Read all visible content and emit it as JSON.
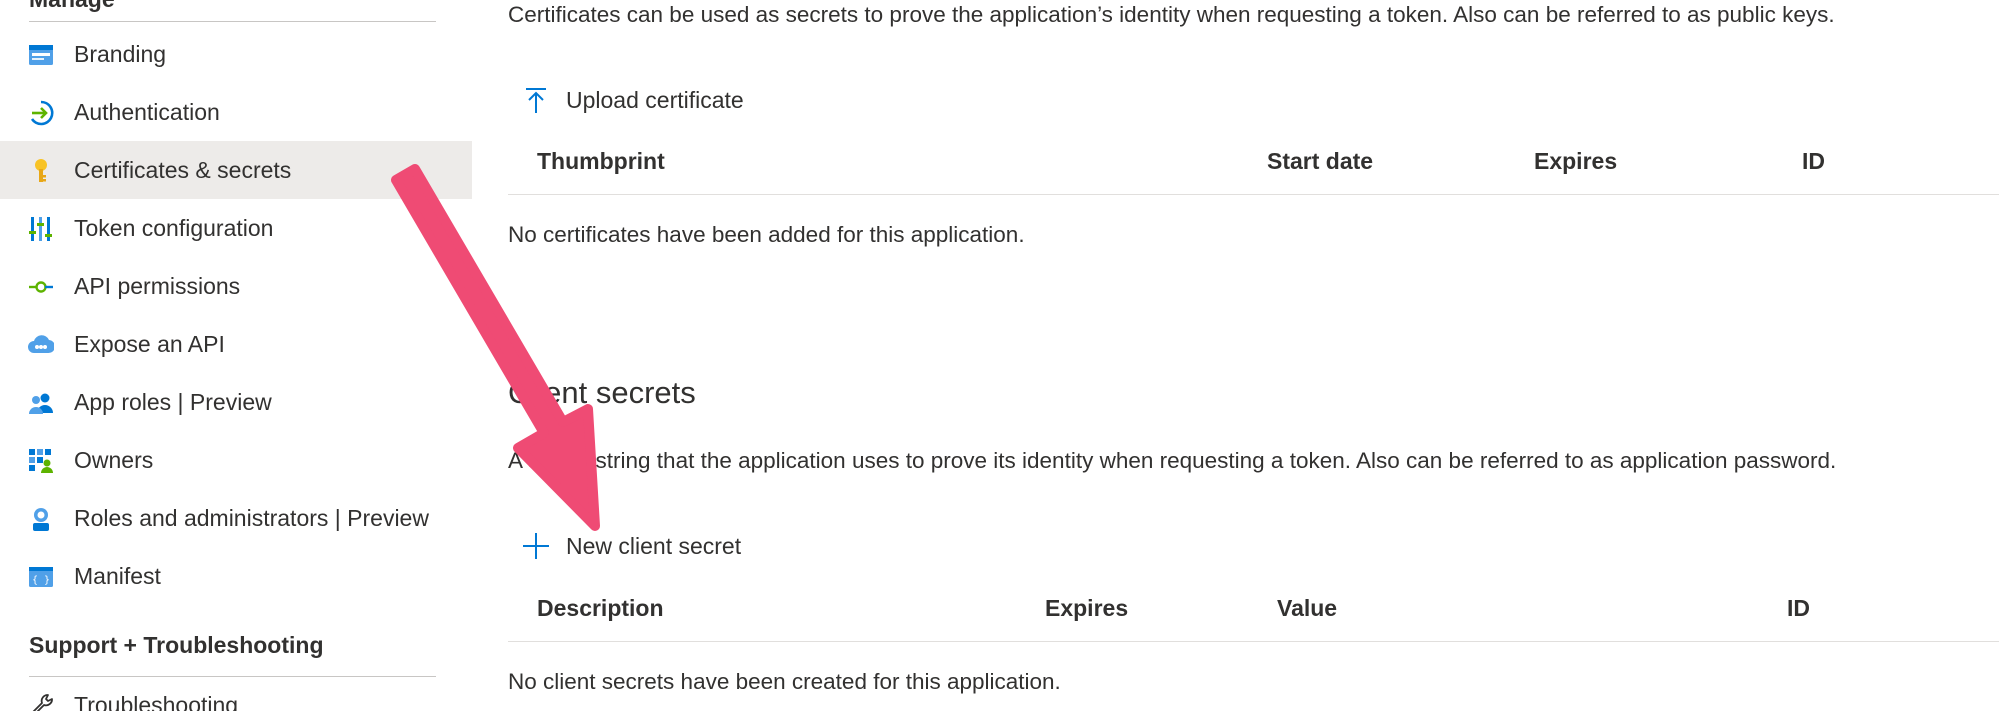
{
  "sidebar": {
    "manage_heading": "Manage",
    "support_heading": "Support + Troubleshooting",
    "items": [
      {
        "label": "Branding",
        "icon": "branding-icon"
      },
      {
        "label": "Authentication",
        "icon": "authentication-icon"
      },
      {
        "label": "Certificates & secrets",
        "icon": "key-icon",
        "active": true
      },
      {
        "label": "Token configuration",
        "icon": "token-configuration-icon"
      },
      {
        "label": "API permissions",
        "icon": "api-permissions-icon"
      },
      {
        "label": "Expose an API",
        "icon": "cloud-icon"
      },
      {
        "label": "App roles | Preview",
        "icon": "users-icon"
      },
      {
        "label": "Owners",
        "icon": "owners-icon"
      },
      {
        "label": "Roles and administrators | Preview",
        "icon": "admin-icon"
      },
      {
        "label": "Manifest",
        "icon": "manifest-icon"
      }
    ],
    "support_items": [
      {
        "label": "Troubleshooting",
        "icon": "wrench-icon"
      }
    ]
  },
  "certificates": {
    "description": "Certificates can be used as secrets to prove the application’s identity when requesting a token. Also can be referred to as public keys.",
    "upload_label": "Upload certificate",
    "columns": [
      "Thumbprint",
      "Start date",
      "Expires",
      "ID"
    ],
    "empty_text": "No certificates have been added for this application."
  },
  "client_secrets": {
    "title": "Client secrets",
    "description": "A secret string that the application uses to prove its identity when requesting a token. Also can be referred to as application password.",
    "new_label": "New client secret",
    "columns": [
      "Description",
      "Expires",
      "Value",
      "ID"
    ],
    "empty_text": "No client secrets have been created for this application."
  },
  "colors": {
    "accent": "#0078d4",
    "active_bg": "#edebe9",
    "annotation_arrow": "#ef4b74"
  }
}
